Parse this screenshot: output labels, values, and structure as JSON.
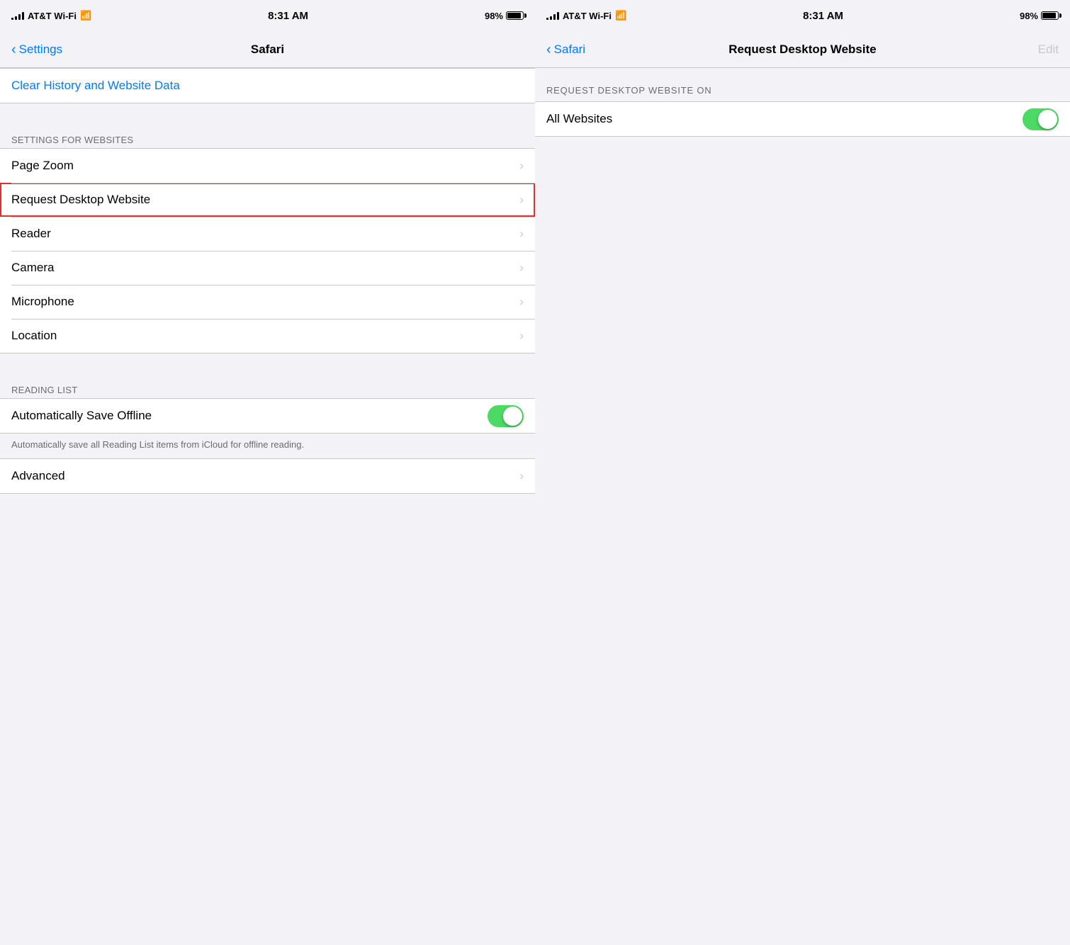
{
  "left_panel": {
    "status_bar": {
      "carrier": "AT&T Wi-Fi",
      "time": "8:31 AM",
      "battery": "98%"
    },
    "nav": {
      "back_label": "Settings",
      "title": "Safari"
    },
    "clear_history": {
      "label": "Clear History and Website Data"
    },
    "settings_for_websites_header": "SETTINGS FOR WEBSITES",
    "menu_items": [
      {
        "label": "Page Zoom",
        "chevron": true,
        "highlighted": false
      },
      {
        "label": "Request Desktop Website",
        "chevron": true,
        "highlighted": true
      },
      {
        "label": "Reader",
        "chevron": true,
        "highlighted": false
      },
      {
        "label": "Camera",
        "chevron": true,
        "highlighted": false
      },
      {
        "label": "Microphone",
        "chevron": true,
        "highlighted": false
      },
      {
        "label": "Location",
        "chevron": true,
        "highlighted": false
      }
    ],
    "reading_list_header": "READING LIST",
    "auto_save": {
      "label": "Automatically Save Offline",
      "toggle_on": true,
      "description": "Automatically save all Reading List items from iCloud for offline reading."
    },
    "advanced": {
      "label": "Advanced",
      "chevron": true
    }
  },
  "right_panel": {
    "status_bar": {
      "carrier": "AT&T Wi-Fi",
      "time": "8:31 AM",
      "battery": "98%"
    },
    "nav": {
      "back_label": "Safari",
      "title": "Request Desktop Website",
      "edit_label": "Edit"
    },
    "section_header": "REQUEST DESKTOP WEBSITE ON",
    "all_websites": {
      "label": "All Websites",
      "toggle_on": true
    }
  }
}
